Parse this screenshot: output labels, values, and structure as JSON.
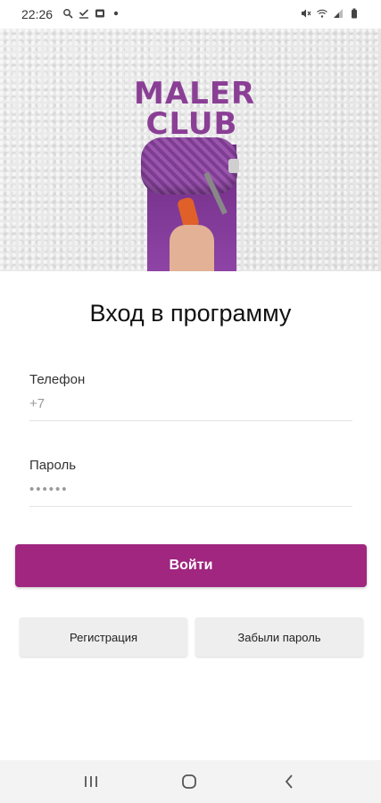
{
  "status_bar": {
    "time": "22:26",
    "left_icons": [
      "search-icon",
      "download-check-icon",
      "gallery-icon",
      "dot-icon"
    ],
    "right_icons": [
      "mute-icon",
      "wifi-icon",
      "signal-icon",
      "battery-icon"
    ]
  },
  "hero": {
    "brand_line1": "MALER",
    "brand_line2": "CLUB",
    "brand_color": "#8a3f95"
  },
  "login": {
    "title": "Вход в программу",
    "phone_label": "Телефон",
    "phone_placeholder": "+7",
    "password_label": "Пароль",
    "password_placeholder": "••••••",
    "submit_label": "Войти",
    "register_label": "Регистрация",
    "forgot_label": "Забыли пароль",
    "accent_color": "#a0267f"
  },
  "nav_bar": {
    "icons": [
      "recent-apps-icon",
      "home-icon",
      "back-icon"
    ]
  }
}
